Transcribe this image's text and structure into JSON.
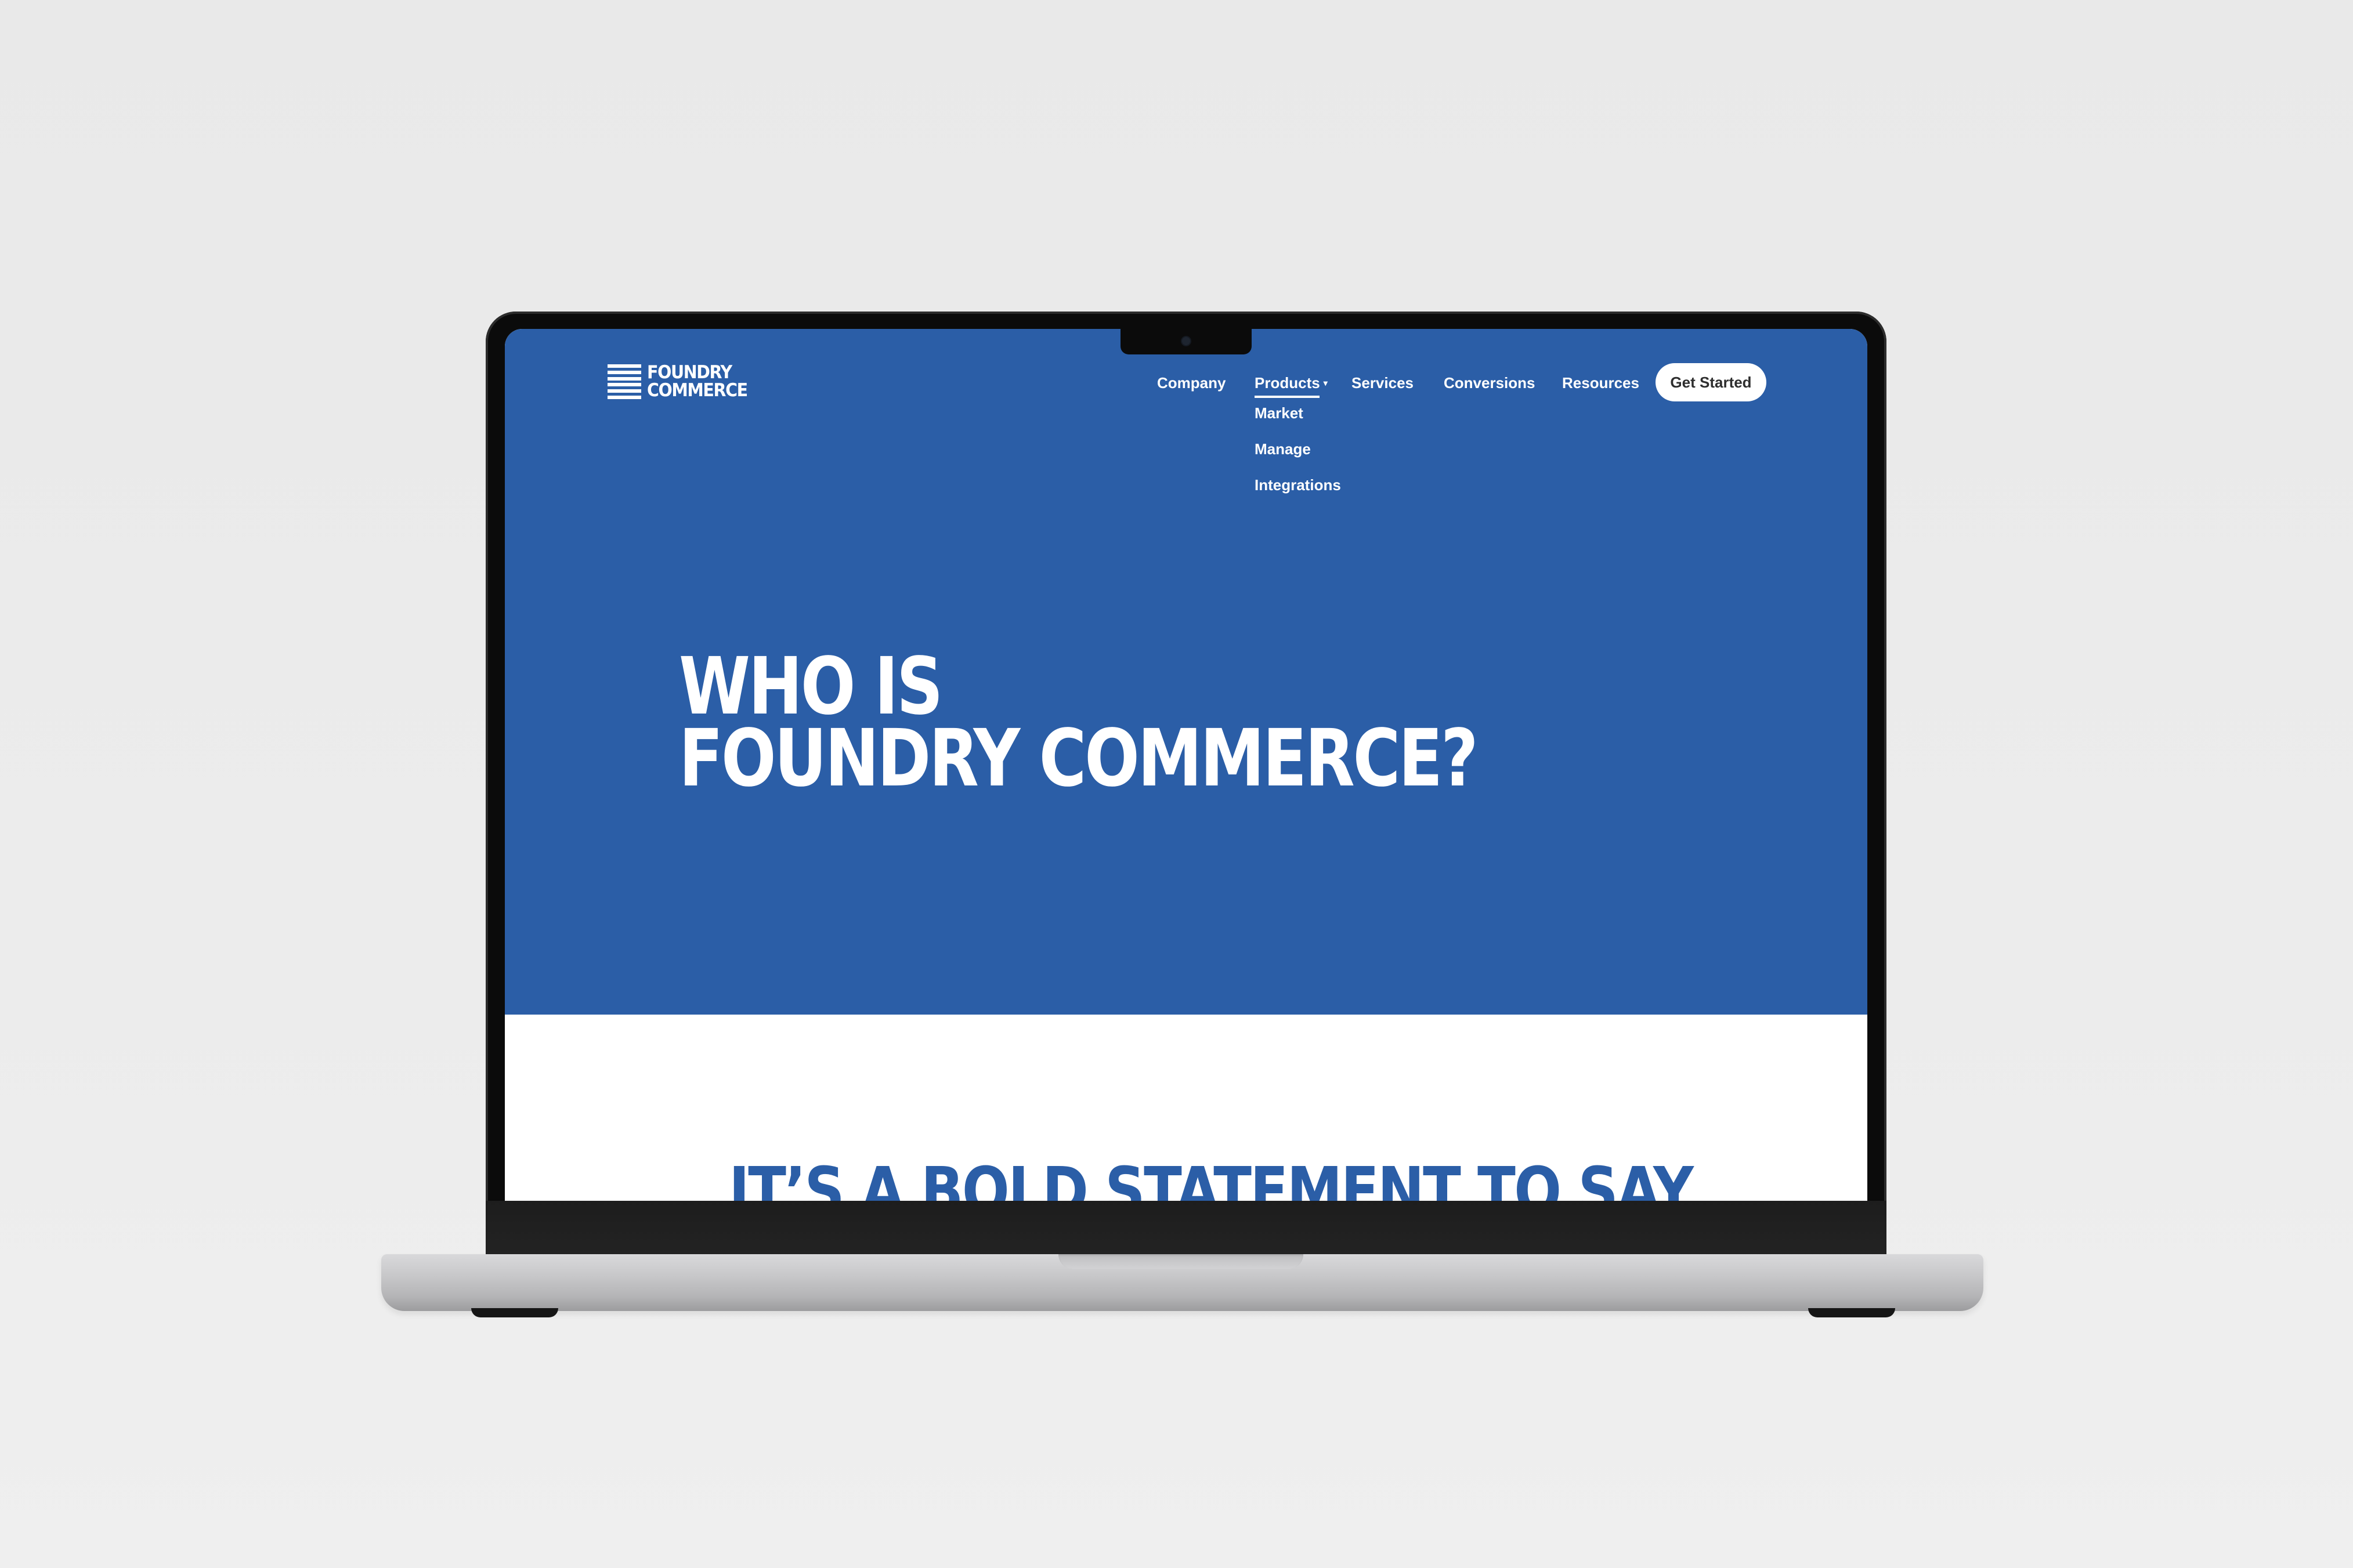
{
  "logo": {
    "line1": "FOUNDRY",
    "line2": "COMMERCE"
  },
  "nav": {
    "items": [
      {
        "label": "Company"
      },
      {
        "label": "Products",
        "active": true,
        "has_dropdown": true
      },
      {
        "label": "Services"
      },
      {
        "label": "Conversions"
      },
      {
        "label": "Resources"
      }
    ],
    "cta_label": "Get Started"
  },
  "products_dropdown": {
    "items": [
      "Market",
      "Manage",
      "Integrations"
    ]
  },
  "hero": {
    "title_line1": "WHO IS",
    "title_line2": "FOUNDRY COMMERCE?"
  },
  "section": {
    "heading": "IT’S A BOLD STATEMENT TO SAY"
  },
  "colors": {
    "brand_blue": "#2b5ea7",
    "background": "#eaeaea",
    "white": "#ffffff"
  },
  "icons": {
    "dropdown_caret": "caret-down-icon",
    "logo_mark": "stripes-logo-icon",
    "camera": "camera-icon"
  }
}
